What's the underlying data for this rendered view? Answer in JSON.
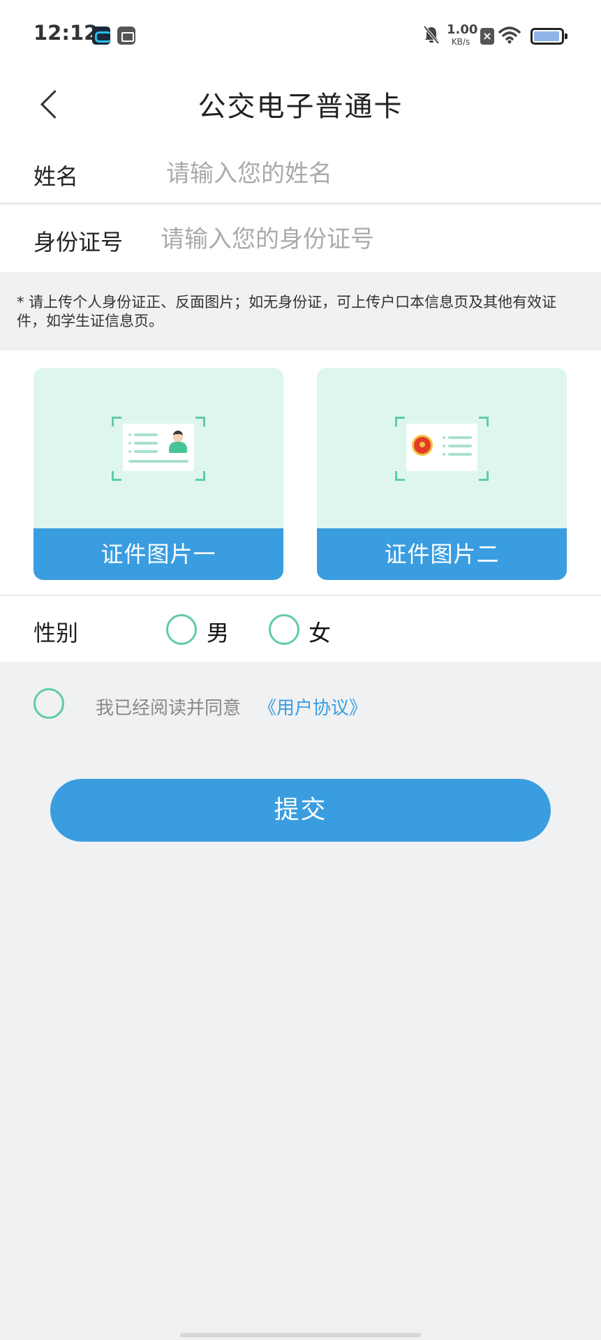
{
  "status_bar": {
    "time": "12:12",
    "net_speed_value": "1.00",
    "net_speed_unit": "KB/s",
    "icons": [
      "app-notification-icon",
      "app-notification-icon",
      "mute-bell-icon",
      "x-app-icon",
      "wifi-icon",
      "battery-icon"
    ]
  },
  "header": {
    "title": "公交电子普通卡",
    "back_icon": "chevron-left-icon"
  },
  "form": {
    "name_label": "姓名",
    "name_placeholder": "请输入您的姓名",
    "name_value": "",
    "id_label": "身份证号",
    "id_placeholder": "请输入您的身份证号",
    "id_value": ""
  },
  "notice": "* 请上传个人身份证正、反面图片；如无身份证，可上传户口本信息页及其他有效证件，如学生证信息页。",
  "uploads": [
    {
      "label": "证件图片一",
      "icon": "id-card-front-icon"
    },
    {
      "label": "证件图片二",
      "icon": "id-card-back-icon"
    }
  ],
  "gender": {
    "label": "性别",
    "options": [
      "男",
      "女"
    ],
    "selected": null
  },
  "agreement": {
    "text": "我已经阅读并同意",
    "link": "《用户协议》",
    "checked": false
  },
  "submit_label": "提交",
  "colors": {
    "accent": "#3a9de0",
    "radio_border": "#5fcca4",
    "card_bg": "#def6ee",
    "page_bg": "#f0f1f3"
  }
}
